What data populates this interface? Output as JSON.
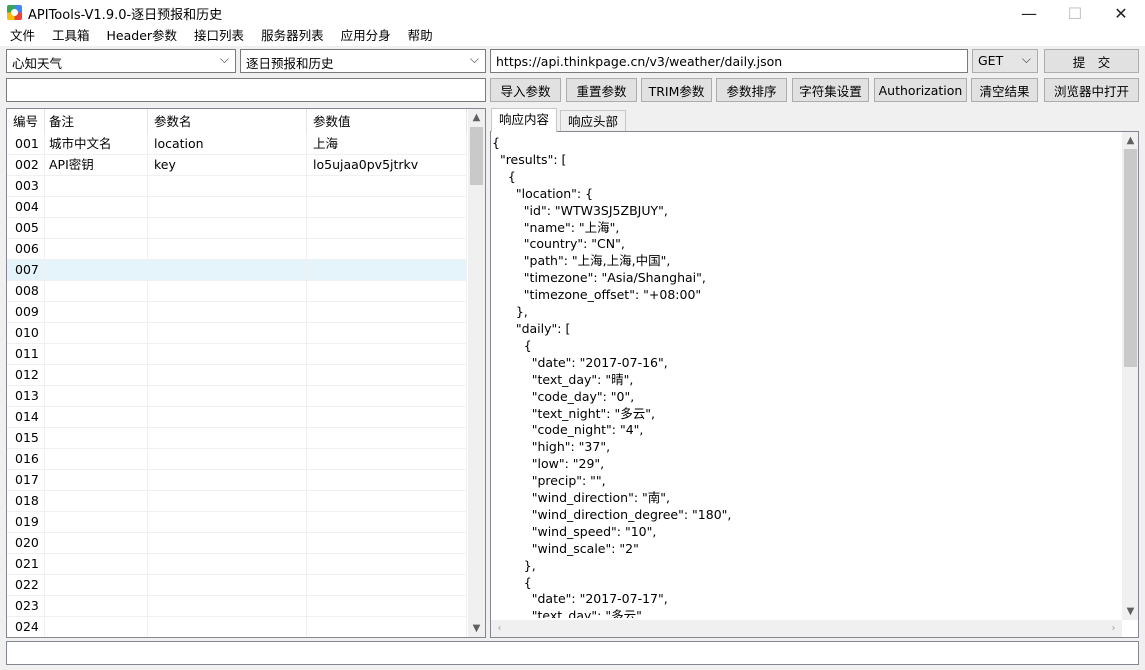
{
  "window": {
    "title": "APITools-V1.9.0-逐日预报和历史",
    "min_glyph": "—",
    "max_glyph": "☐",
    "close_glyph": "✕"
  },
  "menu": [
    "文件",
    "工具箱",
    "Header参数",
    "接口列表",
    "服务器列表",
    "应用分身",
    "帮助"
  ],
  "toolbar": {
    "provider_select": "心知天气",
    "api_select": "逐日预报和历史",
    "url": "https://api.thinkpage.cn/v3/weather/daily.json",
    "method": "GET",
    "submit_label": "提　交",
    "secondary_input": "",
    "buttons": [
      "导入参数",
      "重置参数",
      "TRIM参数",
      "参数排序",
      "字符集设置",
      "Authorization",
      "清空结果",
      "浏览器中打开"
    ]
  },
  "grid": {
    "headers": [
      "编号",
      "备注",
      "参数名",
      "参数值"
    ],
    "rows": [
      {
        "id": "001",
        "note": "城市中文名",
        "name": "location",
        "value": "上海"
      },
      {
        "id": "002",
        "note": "API密钥",
        "name": "key",
        "value": "lo5ujaa0pv5jtrkv"
      },
      {
        "id": "003",
        "note": "",
        "name": "",
        "value": ""
      },
      {
        "id": "004",
        "note": "",
        "name": "",
        "value": ""
      },
      {
        "id": "005",
        "note": "",
        "name": "",
        "value": ""
      },
      {
        "id": "006",
        "note": "",
        "name": "",
        "value": ""
      },
      {
        "id": "007",
        "note": "",
        "name": "",
        "value": ""
      },
      {
        "id": "008",
        "note": "",
        "name": "",
        "value": ""
      },
      {
        "id": "009",
        "note": "",
        "name": "",
        "value": ""
      },
      {
        "id": "010",
        "note": "",
        "name": "",
        "value": ""
      },
      {
        "id": "011",
        "note": "",
        "name": "",
        "value": ""
      },
      {
        "id": "012",
        "note": "",
        "name": "",
        "value": ""
      },
      {
        "id": "013",
        "note": "",
        "name": "",
        "value": ""
      },
      {
        "id": "014",
        "note": "",
        "name": "",
        "value": ""
      },
      {
        "id": "015",
        "note": "",
        "name": "",
        "value": ""
      },
      {
        "id": "016",
        "note": "",
        "name": "",
        "value": ""
      },
      {
        "id": "017",
        "note": "",
        "name": "",
        "value": ""
      },
      {
        "id": "018",
        "note": "",
        "name": "",
        "value": ""
      },
      {
        "id": "019",
        "note": "",
        "name": "",
        "value": ""
      },
      {
        "id": "020",
        "note": "",
        "name": "",
        "value": ""
      },
      {
        "id": "021",
        "note": "",
        "name": "",
        "value": ""
      },
      {
        "id": "022",
        "note": "",
        "name": "",
        "value": ""
      },
      {
        "id": "023",
        "note": "",
        "name": "",
        "value": ""
      },
      {
        "id": "024",
        "note": "",
        "name": "",
        "value": ""
      }
    ],
    "selected_row": "007"
  },
  "tabs": [
    "响应内容",
    "响应头部"
  ],
  "active_tab": "响应内容",
  "response_lines": [
    "{",
    "  \"results\": [",
    "    {",
    "      \"location\": {",
    "        \"id\": \"WTW3SJ5ZBJUY\",",
    "        \"name\": \"上海\",",
    "        \"country\": \"CN\",",
    "        \"path\": \"上海,上海,中国\",",
    "        \"timezone\": \"Asia/Shanghai\",",
    "        \"timezone_offset\": \"+08:00\"",
    "      },",
    "      \"daily\": [",
    "        {",
    "          \"date\": \"2017-07-16\",",
    "          \"text_day\": \"晴\",",
    "          \"code_day\": \"0\",",
    "          \"text_night\": \"多云\",",
    "          \"code_night\": \"4\",",
    "          \"high\": \"37\",",
    "          \"low\": \"29\",",
    "          \"precip\": \"\",",
    "          \"wind_direction\": \"南\",",
    "          \"wind_direction_degree\": \"180\",",
    "          \"wind_speed\": \"10\",",
    "          \"wind_scale\": \"2\"",
    "        },",
    "        {",
    "          \"date\": \"2017-07-17\",",
    "          \"text_day\": \"多云\","
  ],
  "icons": {
    "dropdown": "chevron-down-icon",
    "scroll_up": "arrow-up-icon",
    "scroll_down": "arrow-down-icon",
    "scroll_left": "arrow-left-icon",
    "scroll_right": "arrow-right-icon"
  },
  "status": ""
}
